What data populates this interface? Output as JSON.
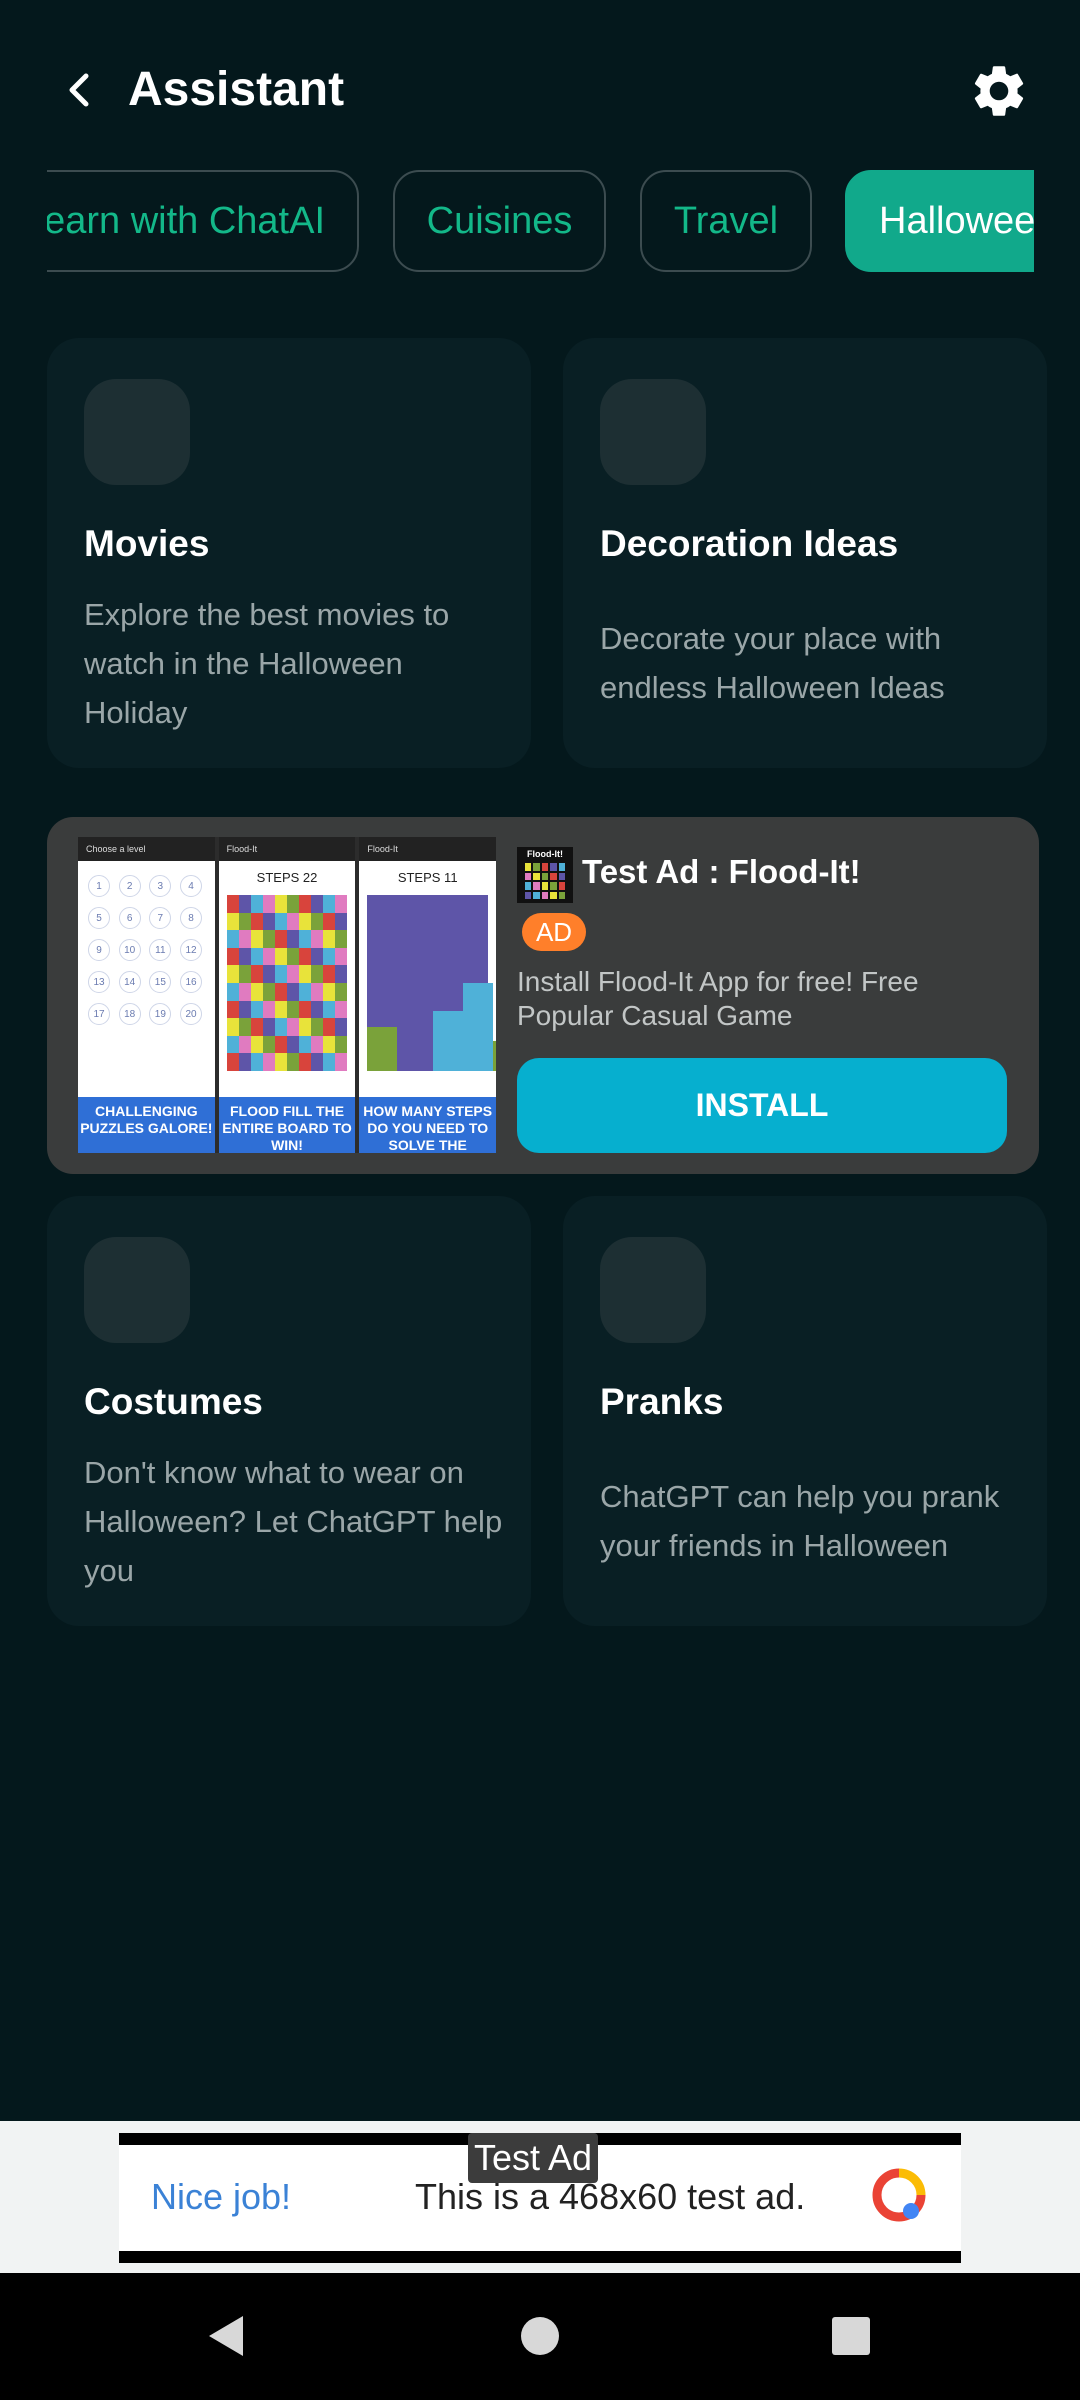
{
  "header": {
    "title": "Assistant"
  },
  "chips": [
    "earn with ChatAI",
    "Cuisines",
    "Travel",
    "Halloween"
  ],
  "cards": [
    {
      "title": "Movies",
      "description": "Explore the best movies to watch in the Halloween Holiday"
    },
    {
      "title": "Decoration Ideas",
      "description": "Decorate your place with endless Halloween Ideas"
    },
    {
      "title": "Costumes",
      "description": "Don't know what to wear on Halloween? Let ChatGPT help you"
    },
    {
      "title": "Pranks",
      "description": "ChatGPT can help you prank your friends in Halloween"
    }
  ],
  "native_ad": {
    "title": "Test Ad : Flood-It!",
    "badge": "AD",
    "body": "Install Flood-It App for free! Free Popular Casual Game",
    "install_label": "INSTALL",
    "logo_text": "Flood-It!",
    "screenshots": [
      {
        "bar": "Choose a level",
        "caption": "CHALLENGING PUZZLES GALORE!"
      },
      {
        "bar": "Flood-It",
        "steps": "STEPS 22",
        "caption": "FLOOD FILL THE ENTIRE BOARD TO WIN!"
      },
      {
        "bar": "Flood-It",
        "steps": "STEPS 11",
        "caption": "HOW MANY STEPS DO YOU NEED TO SOLVE THE PUZZLE?"
      }
    ],
    "levels": [
      "1",
      "2",
      "3",
      "4",
      "5",
      "6",
      "7",
      "8",
      "9",
      "10",
      "11",
      "12",
      "13",
      "14",
      "15",
      "16",
      "17",
      "18",
      "19",
      "20"
    ]
  },
  "banner_ad": {
    "label": "Test Ad",
    "nice": "Nice job!",
    "message": "This is a 468x60 test ad."
  },
  "colors": {
    "background": "#04181c",
    "card": "#091f24",
    "accent": "#11a98b",
    "install": "#06afcf",
    "ad_badge": "#ff7f2a"
  }
}
